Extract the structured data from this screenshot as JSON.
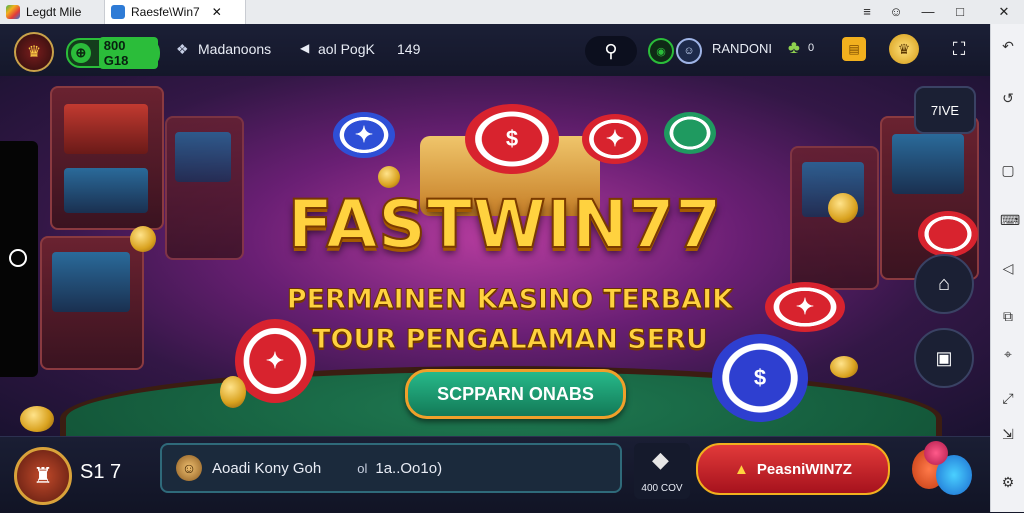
{
  "window": {
    "tabs": [
      {
        "label": "Legdt Mile"
      },
      {
        "label": "Raesfe\\Win7"
      }
    ],
    "close_tab_glyph": "✕",
    "controls": [
      "≡",
      "☺",
      "—",
      "□",
      "✕"
    ]
  },
  "topbar": {
    "balance": "800 G18",
    "username": "Madanoons",
    "page_label": "aol PogK",
    "page_count": "149",
    "random_label": "RANDONI",
    "gift_count": "0"
  },
  "banner": {
    "logo": "FASTWIN77",
    "tagline_1": "PERMAINEN KASINO TERBAIK",
    "tagline_2": "TOUR PENGALAMAN SERU",
    "cta": "SCPPARN ONABS",
    "time_badge": "7IVE",
    "chip_symbol_1": "$",
    "chip_symbol_2": "$"
  },
  "bottombar": {
    "level": "S1 7",
    "account_name": "Aoadi Kony Goh",
    "account_value": "1a..Oo1o)",
    "account_prefix": "ol",
    "diamond_label": "400 COV",
    "promo_button": "PeasniWIN7Z"
  },
  "colors": {
    "accent_gold": "#ffd23f",
    "cta_green": "#1f9c70",
    "promo_red": "#c61e2a",
    "balance_green": "#2bbd3a"
  }
}
